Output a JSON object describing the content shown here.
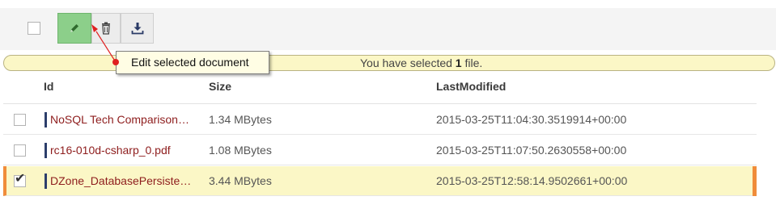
{
  "toolbar": {
    "edit_icon": "pencil-icon",
    "delete_icon": "trash-icon",
    "download_icon": "download-icon"
  },
  "selection": {
    "prefix": "You have selected ",
    "count": "1",
    "suffix": " file."
  },
  "tooltip": {
    "text": "Edit selected document"
  },
  "table": {
    "columns": [
      "Id",
      "Size",
      "LastModified"
    ],
    "rows": [
      {
        "id": "NoSQL Tech Comparison…",
        "size": "1.34 MBytes",
        "modified": "2015-03-25T11:04:30.3519914+00:00",
        "selected": false
      },
      {
        "id": "rc16-010d-csharp_0.pdf",
        "size": "1.08 MBytes",
        "modified": "2015-03-25T11:07:50.2630558+00:00",
        "selected": false
      },
      {
        "id": "DZone_DatabasePersiste…",
        "size": "3.44 MBytes",
        "modified": "2015-03-25T12:58:14.9502661+00:00",
        "selected": true
      }
    ]
  },
  "colors": {
    "edit_button": "#8ccf8a",
    "selected_row": "#fbf7c6",
    "selected_accent": "#f08c3a",
    "id_text": "#8e1d1d",
    "pointer": "#e02020"
  }
}
